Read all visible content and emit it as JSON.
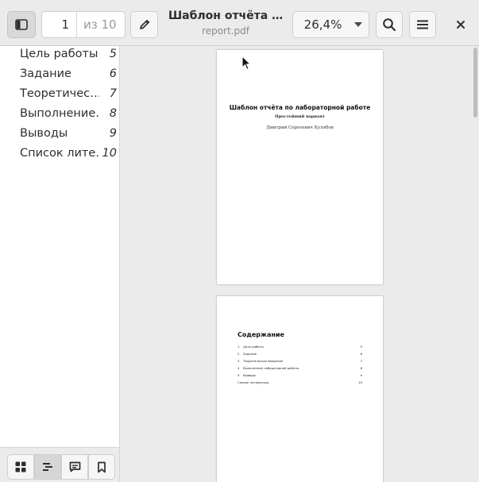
{
  "header": {
    "current_page": "1",
    "total_pages": "из 10",
    "title": "Шаблон отчёта …",
    "filename": "report.pdf",
    "zoom": "26,4%"
  },
  "sidebar": {
    "outline": [
      {
        "label": "Цель работы",
        "page": "5"
      },
      {
        "label": "Задание",
        "page": "6"
      },
      {
        "label": "Теоретичес…",
        "page": "7"
      },
      {
        "label": "Выполнение…",
        "page": "8"
      },
      {
        "label": "Выводы",
        "page": "9"
      },
      {
        "label": "Список лите…",
        "page": "10"
      }
    ],
    "footer_tabs": [
      "thumbnails",
      "outline",
      "annotations",
      "bookmarks"
    ]
  },
  "document": {
    "page1": {
      "title": "Шаблон отчёта по лабораторной работе",
      "subtitle": "Простейший вариант",
      "author": "Дмитрий Сергеевич Кулябов"
    },
    "page2": {
      "heading": "Содержание",
      "toc": [
        {
          "num": "1",
          "label": "Цель работы",
          "page": "5"
        },
        {
          "num": "2",
          "label": "Задание",
          "page": "6"
        },
        {
          "num": "3",
          "label": "Теоретическое введение",
          "page": "7"
        },
        {
          "num": "4",
          "label": "Выполнение лабораторной работы",
          "page": "8"
        },
        {
          "num": "5",
          "label": "Выводы",
          "page": "9"
        },
        {
          "num": "",
          "label": "Список литературы",
          "page": "10"
        }
      ]
    }
  },
  "colors": {
    "header_bg": "#ebebeb",
    "doc_bg": "#ebebeb",
    "text": "#2e2e2e"
  }
}
